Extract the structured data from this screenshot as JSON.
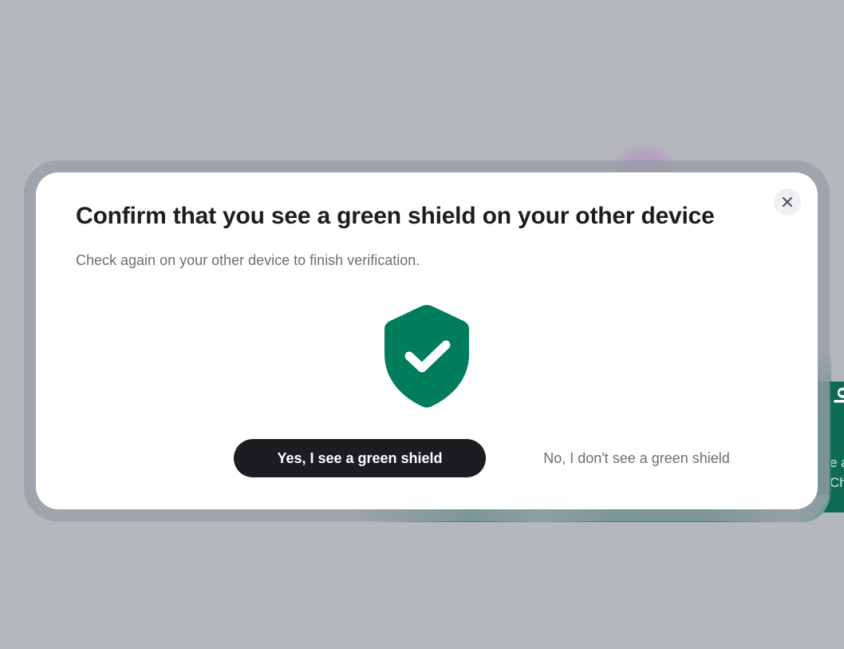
{
  "background": {
    "panel_heading_fragment": "lo",
    "panel_line_1": "e a",
    "panel_line_2": "Ch"
  },
  "dialog": {
    "title": "Confirm that you see a green shield on your other device",
    "subtitle": "Check again on your other device to finish verification.",
    "close_icon": "close-icon",
    "shield_icon": "green-shield-check-icon",
    "confirm_label": "Yes, I see a green shield",
    "deny_label": "No, I don't see a green shield"
  },
  "colors": {
    "shield": "#017D5C",
    "primary_button": "#1C1D21",
    "overlay": "#B4B7BB"
  }
}
